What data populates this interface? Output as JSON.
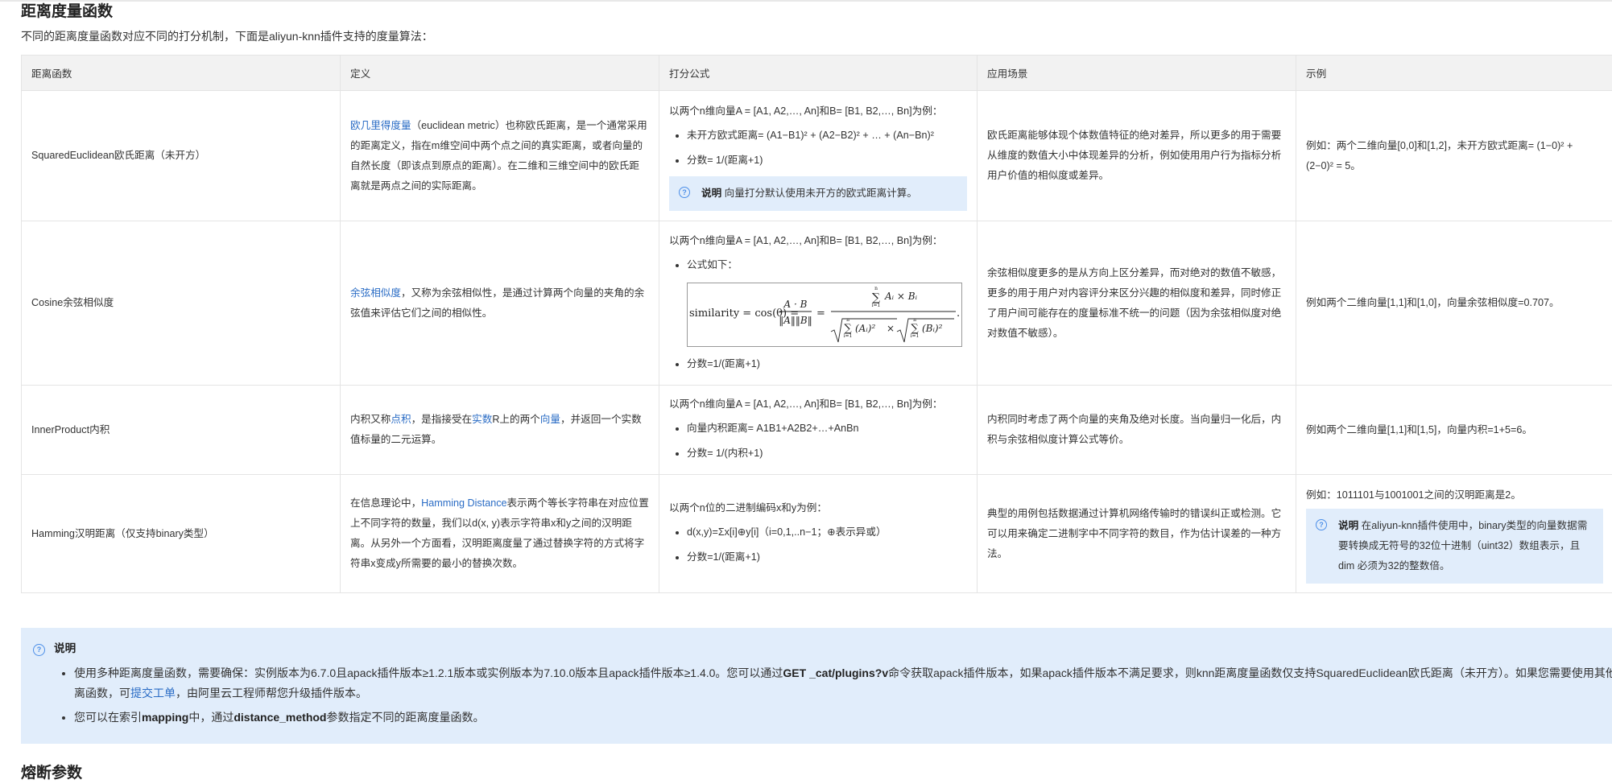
{
  "section_title": "距离度量函数",
  "intro": "不同的距离度量函数对应不同的打分机制，下面是aliyun-knn插件支持的度量算法：",
  "table": {
    "headers": [
      "距离函数",
      "定义",
      "打分公式",
      "应用场景",
      "示例"
    ],
    "rows": [
      {
        "name": "SquaredEuclidean欧氏距离（未开方）",
        "def_link": "欧几里得度量",
        "def_rest": "（euclidean metric）也称欧氏距离，是一个通常采用的距离定义，指在m维空间中两个点之间的真实距离，或者向量的自然长度（即该点到原点的距离）。在二维和三维空间中的欧氏距离就是两点之间的实际距离。",
        "formula_intro": "以两个n维向量A = [A1, A2,…, An]和B= [B1, B2,…, Bn]为例：",
        "formula_items": [
          "未开方欧式距离= (A1−B1)² + (A2−B2)² + … + (An−Bn)²",
          "分数= 1/(距离+1)"
        ],
        "formula_note_label": "说明",
        "formula_note_text": " 向量打分默认使用未开方的欧式距离计算。",
        "scenario": "欧氏距离能够体现个体数值特征的绝对差异，所以更多的用于需要从维度的数值大小中体现差异的分析，例如使用用户行为指标分析用户价值的相似度或差异。",
        "example": "例如：两个二维向量[0,0]和[1,2]，未开方欧式距离= (1−0)² + (2−0)² = 5。"
      },
      {
        "name": "Cosine余弦相似度",
        "def_link": "余弦相似度",
        "def_rest": "，又称为余弦相似性，是通过计算两个向量的夹角的余弦值来评估它们之间的相似性。",
        "formula_intro": "以两个n维向量A = [A1, A2,…, An]和B= [B1, B2,…, Bn]为例：",
        "formula_items": [
          "公式如下：",
          "分数=1/(距离+1)"
        ],
        "formula_image_text": {
          "lhs": "similarity = cos(θ) =",
          "frac1_num": "A · B",
          "frac1_den": "‖A‖‖B‖",
          "eq": "=",
          "sum_top": "n",
          "sum_sym": "∑",
          "sum_bottom": "i=1",
          "num_term": "Aᵢ × Bᵢ",
          "den_term_a": "(Aᵢ)²",
          "den_term_b": "(Bᵢ)²",
          "times": "×",
          "end": "."
        },
        "scenario": "余弦相似度更多的是从方向上区分差异，而对绝对的数值不敏感，更多的用于用户对内容评分来区分兴趣的相似度和差异，同时修正了用户间可能存在的度量标准不统一的问题（因为余弦相似度对绝对数值不敏感）。",
        "example": "例如两个二维向量[1,1]和[1,0]，向量余弦相似度=0.707。"
      },
      {
        "name": "InnerProduct内积",
        "def_p1": "内积又称",
        "def_link1": "点积",
        "def_p2": "，是指接受在",
        "def_link2": "实数",
        "def_p3": "R上的两个",
        "def_link3": "向量",
        "def_p4": "，并返回一个实数值标量的二元运算。",
        "formula_intro": "以两个n维向量A = [A1, A2,…, An]和B= [B1, B2,…, Bn]为例：",
        "formula_items": [
          "向量内积距离= A1B1+A2B2+…+AnBn",
          "分数= 1/(内积+1)"
        ],
        "scenario": "内积同时考虑了两个向量的夹角及绝对长度。当向量归一化后，内积与余弦相似度计算公式等价。",
        "example": "例如两个二维向量[1,1]和[1,5]，向量内积=1+5=6。"
      },
      {
        "name": "Hamming汉明距离（仅支持binary类型）",
        "def_p1": "在信息理论中，",
        "def_link": "Hamming Distance",
        "def_p2": "表示两个等长字符串在对应位置上不同字符的数量，我们以d(x, y)表示字符串x和y之间的汉明距离。从另外一个方面看，汉明距离度量了通过替换字符的方式将字符串x变成y所需要的最小的替换次数。",
        "formula_intro": "以两个n位的二进制编码x和y为例：",
        "formula_items": [
          "d(x,y)=Σx[i]⊕y[i]（i=0,1,..n−1；⊕表示异或）",
          "分数=1/(距离+1)"
        ],
        "scenario": "典型的用例包括数据通过计算机网络传输时的错误纠正或检测。它可以用来确定二进制字中不同字符的数目，作为估计误差的一种方法。",
        "example": "例如：1011101与1001001之间的汉明距离是2。",
        "example_note_label": "说明",
        "example_note_text": " 在aliyun-knn插件使用中，binary类型的向量数据需要转换成无符号的32位十进制（uint32）数组表示，且 dim 必须为32的整数倍。"
      }
    ]
  },
  "bottom_note": {
    "title": "说明",
    "item1_a": "使用多种距离度量函数，需要确保：实例版本为6.7.0且apack插件版本≥1.2.1版本或实例版本为7.10.0版本且apack插件版本≥1.4.0。您可以通过",
    "item1_code": "GET _cat/plugins?v",
    "item1_b": "命令获取apack插件版本，如果apack插件版本不满足要求，则knn距离度量函数仅支持SquaredEuclidean欧氏距离（未开方）。如果您需要使用其他距离函数，可",
    "item1_link": "提交工单",
    "item1_c": "，由阿里云工程师帮您升级插件版本。",
    "item2_a": "您可以在索引",
    "item2_code1": "mapping",
    "item2_b": "中，通过",
    "item2_code2": "distance_method",
    "item2_c": "参数指定不同的距离度量函数。"
  },
  "next_section_title": "熔断参数",
  "colors": {
    "link": "#2a6cc5",
    "note_bg": "#e1edfb",
    "header_bg": "#f2f2f2",
    "note_icon": "#4b8ee8"
  }
}
